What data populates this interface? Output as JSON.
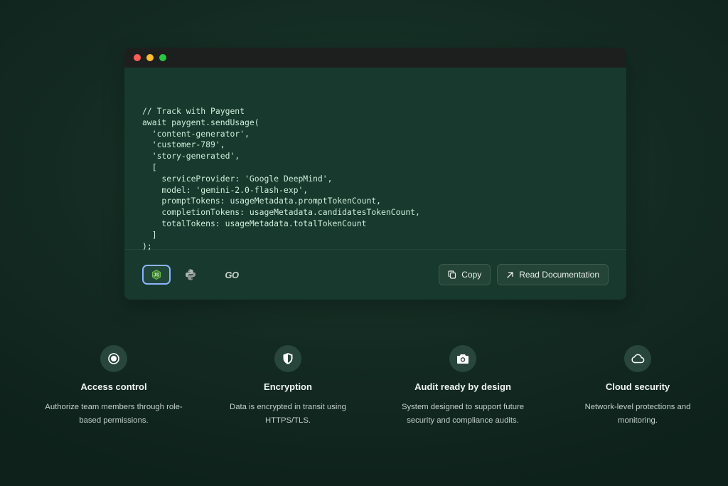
{
  "code": {
    "lines": [
      "// Track with Paygent",
      "await paygent.sendUsage(",
      "  'content-generator',",
      "  'customer-789',",
      "  'story-generated',",
      "  [",
      "    serviceProvider: 'Google DeepMind',",
      "    model: 'gemini-2.0-flash-exp',",
      "    promptTokens: usageMetadata.promptTokenCount,",
      "    completionTokens: usageMetadata.candidatesTokenCount,",
      "    totalTokens: usageMetadata.totalTokenCount",
      "  ]",
      ");"
    ]
  },
  "languages": {
    "items": [
      {
        "name": "node-icon",
        "active": true
      },
      {
        "name": "python-icon",
        "active": false
      },
      {
        "name": "go-icon",
        "active": false,
        "label": "GO"
      }
    ]
  },
  "actions": {
    "copy_label": "Copy",
    "docs_label": "Read Documentation"
  },
  "features": [
    {
      "icon": "record-icon",
      "title": "Access control",
      "desc_line1": "Authorize team members through role-",
      "desc_line2": "based permissions."
    },
    {
      "icon": "shield-icon",
      "title": "Encryption",
      "desc_line1": "Data is encrypted in transit using",
      "desc_line2": "HTTPS/TLS."
    },
    {
      "icon": "camera-icon",
      "title": "Audit ready by design",
      "desc_line1": "System designed to support future",
      "desc_line2": "security and compliance audits."
    },
    {
      "icon": "cloud-icon",
      "title": "Cloud security",
      "desc_line1": "Network-level protections and",
      "desc_line2": "monitoring."
    }
  ],
  "colors": {
    "background": "#132a22",
    "code_panel": "#18392d",
    "active_outline": "#8ab4ff",
    "node_green": "#6cc24a"
  }
}
